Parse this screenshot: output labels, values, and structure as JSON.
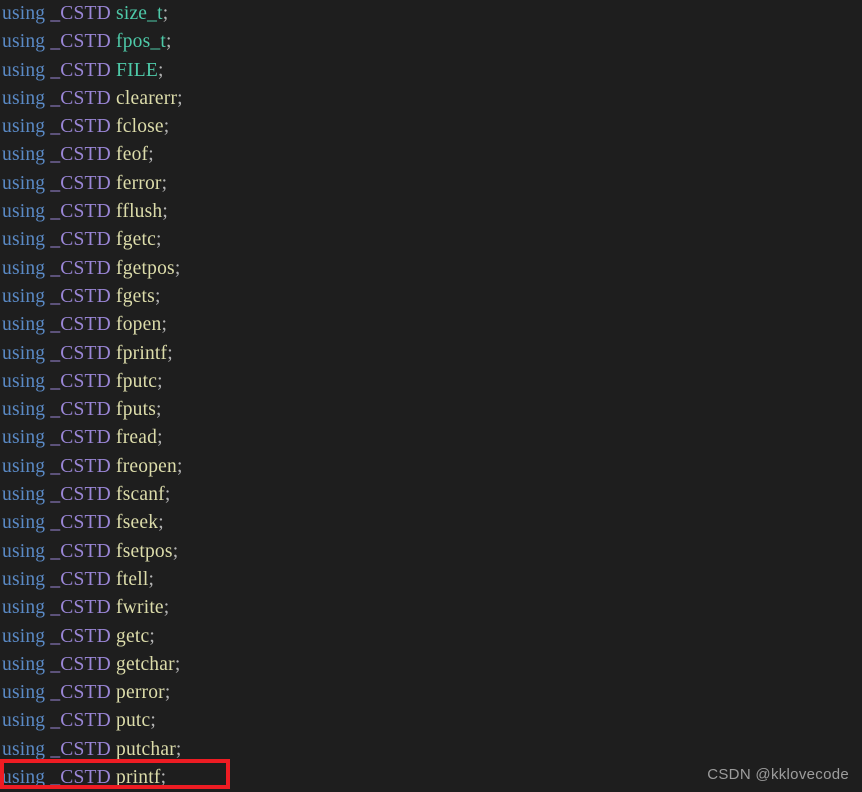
{
  "editor": {
    "background_color": "#1e1e1e",
    "syntax_colors": {
      "keyword": "#5a8ac6",
      "macro": "#9a86d6",
      "type": "#4ec9a8",
      "function": "#dcdcaa",
      "punctuation": "#b4b4b4"
    },
    "keyword": "using",
    "macro": "_CSTD",
    "terminator": ";",
    "lines": [
      {
        "keyword": "using",
        "macro": "_CSTD",
        "symbol": "size_t",
        "kind": "type",
        "terminator": ";"
      },
      {
        "keyword": "using",
        "macro": "_CSTD",
        "symbol": "fpos_t",
        "kind": "type",
        "terminator": ";"
      },
      {
        "keyword": "using",
        "macro": "_CSTD",
        "symbol": "FILE",
        "kind": "type",
        "terminator": ";"
      },
      {
        "keyword": "using",
        "macro": "_CSTD",
        "symbol": "clearerr",
        "kind": "function",
        "terminator": ";"
      },
      {
        "keyword": "using",
        "macro": "_CSTD",
        "symbol": "fclose",
        "kind": "function",
        "terminator": ";"
      },
      {
        "keyword": "using",
        "macro": "_CSTD",
        "symbol": "feof",
        "kind": "function",
        "terminator": ";"
      },
      {
        "keyword": "using",
        "macro": "_CSTD",
        "symbol": "ferror",
        "kind": "function",
        "terminator": ";"
      },
      {
        "keyword": "using",
        "macro": "_CSTD",
        "symbol": "fflush",
        "kind": "function",
        "terminator": ";"
      },
      {
        "keyword": "using",
        "macro": "_CSTD",
        "symbol": "fgetc",
        "kind": "function",
        "terminator": ";"
      },
      {
        "keyword": "using",
        "macro": "_CSTD",
        "symbol": "fgetpos",
        "kind": "function",
        "terminator": ";"
      },
      {
        "keyword": "using",
        "macro": "_CSTD",
        "symbol": "fgets",
        "kind": "function",
        "terminator": ";"
      },
      {
        "keyword": "using",
        "macro": "_CSTD",
        "symbol": "fopen",
        "kind": "function",
        "terminator": ";"
      },
      {
        "keyword": "using",
        "macro": "_CSTD",
        "symbol": "fprintf",
        "kind": "function",
        "terminator": ";"
      },
      {
        "keyword": "using",
        "macro": "_CSTD",
        "symbol": "fputc",
        "kind": "function",
        "terminator": ";"
      },
      {
        "keyword": "using",
        "macro": "_CSTD",
        "symbol": "fputs",
        "kind": "function",
        "terminator": ";"
      },
      {
        "keyword": "using",
        "macro": "_CSTD",
        "symbol": "fread",
        "kind": "function",
        "terminator": ";"
      },
      {
        "keyword": "using",
        "macro": "_CSTD",
        "symbol": "freopen",
        "kind": "function",
        "terminator": ";"
      },
      {
        "keyword": "using",
        "macro": "_CSTD",
        "symbol": "fscanf",
        "kind": "function",
        "terminator": ";"
      },
      {
        "keyword": "using",
        "macro": "_CSTD",
        "symbol": "fseek",
        "kind": "function",
        "terminator": ";"
      },
      {
        "keyword": "using",
        "macro": "_CSTD",
        "symbol": "fsetpos",
        "kind": "function",
        "terminator": ";"
      },
      {
        "keyword": "using",
        "macro": "_CSTD",
        "symbol": "ftell",
        "kind": "function",
        "terminator": ";"
      },
      {
        "keyword": "using",
        "macro": "_CSTD",
        "symbol": "fwrite",
        "kind": "function",
        "terminator": ";"
      },
      {
        "keyword": "using",
        "macro": "_CSTD",
        "symbol": "getc",
        "kind": "function",
        "terminator": ";"
      },
      {
        "keyword": "using",
        "macro": "_CSTD",
        "symbol": "getchar",
        "kind": "function",
        "terminator": ";"
      },
      {
        "keyword": "using",
        "macro": "_CSTD",
        "symbol": "perror",
        "kind": "function",
        "terminator": ";"
      },
      {
        "keyword": "using",
        "macro": "_CSTD",
        "symbol": "putc",
        "kind": "function",
        "terminator": ";"
      },
      {
        "keyword": "using",
        "macro": "_CSTD",
        "symbol": "putchar",
        "kind": "function",
        "terminator": ";"
      },
      {
        "keyword": "using",
        "macro": "_CSTD",
        "symbol": "printf",
        "kind": "function",
        "terminator": ";"
      }
    ]
  },
  "annotation": {
    "type": "rectangle",
    "color": "#ee1c23",
    "target_line_symbol": "printf"
  },
  "watermark": {
    "text": "CSDN @kklovecode",
    "color": "#9d9d9d"
  }
}
